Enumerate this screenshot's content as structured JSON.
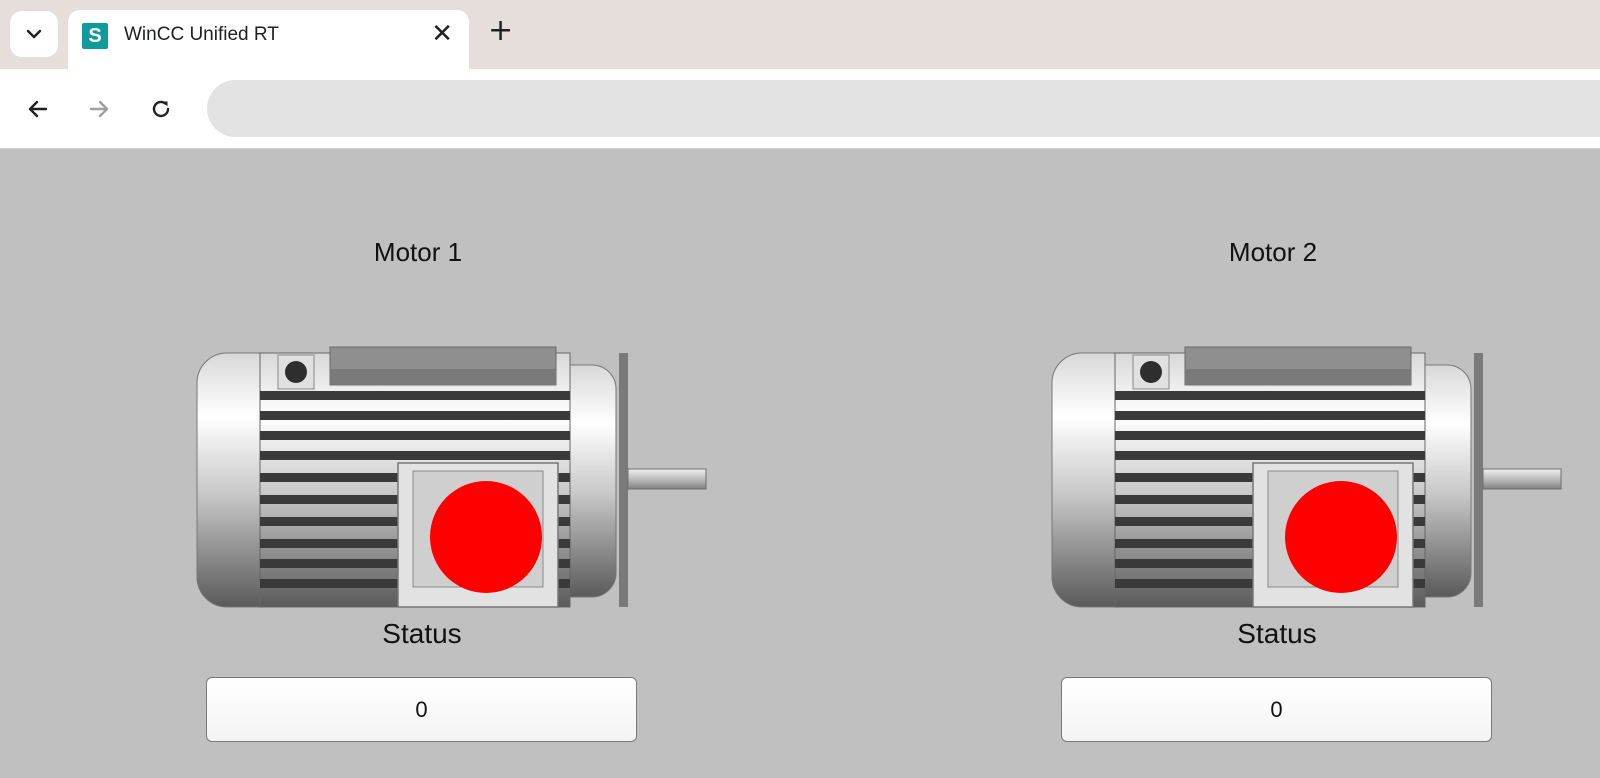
{
  "browser": {
    "tab_title": "WinCC Unified RT",
    "favicon_letter": "S",
    "close_glyph": "✕",
    "new_tab_glyph": "+",
    "address": ""
  },
  "colors": {
    "hmi_background": "#c0c0c0",
    "status_indicator_off": "#ff0000",
    "favicon": "#0f9b9b"
  },
  "motors": [
    {
      "title": "Motor 1",
      "status_label": "Status",
      "status_value": "0",
      "indicator": "red"
    },
    {
      "title": "Motor 2",
      "status_label": "Status",
      "status_value": "0",
      "indicator": "red"
    }
  ]
}
